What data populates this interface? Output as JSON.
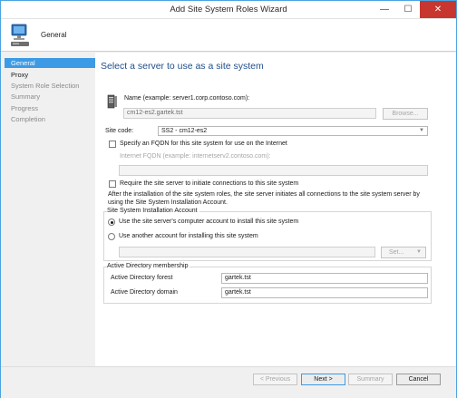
{
  "window": {
    "title": "Add Site System Roles Wizard",
    "min_glyph": "—",
    "max_glyph": "☐",
    "close_glyph": "✕"
  },
  "header": {
    "title": "General",
    "icon": "computer-icon"
  },
  "sidebar": {
    "items": [
      {
        "label": "General",
        "state": "active"
      },
      {
        "label": "Proxy",
        "state": "current"
      },
      {
        "label": "System Role Selection",
        "state": "disabled"
      },
      {
        "label": "Summary",
        "state": "disabled"
      },
      {
        "label": "Progress",
        "state": "disabled"
      },
      {
        "label": "Completion",
        "state": "disabled"
      }
    ]
  },
  "main": {
    "heading": "Select a server to use as a site system",
    "server_icon": "server-icon",
    "name_label": "Name (example: server1.corp.contoso.com):",
    "name_value": "cm12-es2.gartek.tst",
    "browse_label": "Browse...",
    "site_code_label": "Site code:",
    "site_code_value": "SS2 - cm12-es2",
    "fqdn_checkbox_label": "Specify an FQDN for this site system for use on the Internet",
    "internet_fqdn_label": "Internet FQDN (example: internetserv2.contoso.com):",
    "internet_fqdn_value": "",
    "require_checkbox_label": "Require the site server to initiate connections to this site system",
    "require_note": "After the  installation of the site system roles, the site server initiates all connections to the site system server by using the Site System Installation Account.",
    "install_account": {
      "group_title": "Site System Installation Account",
      "radio_computer_label": "Use the site server's computer account to install this site system",
      "radio_another_label": "Use another account for installing this site system",
      "account_value": "",
      "set_label": "Set..."
    },
    "ad_membership": {
      "group_title": "Active Directory membership",
      "forest_label": "Active Directory forest",
      "forest_value": "gartek.tst",
      "domain_label": "Active Directory domain",
      "domain_value": "gartek.tst"
    }
  },
  "footer": {
    "previous_label": "< Previous",
    "next_label": "Next >",
    "summary_label": "Summary",
    "cancel_label": "Cancel"
  },
  "colors": {
    "accent": "#3d9ae4",
    "heading": "#1f4e8c",
    "close_button": "#c7372f"
  }
}
